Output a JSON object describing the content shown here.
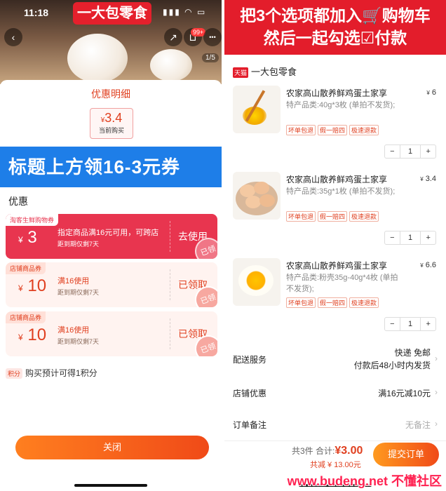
{
  "left": {
    "status_time": "11:18",
    "status_icons": "▮▮▮ ◠ ▭",
    "brand_banner": "一大包零食",
    "back_icon": "‹",
    "share_icon": "↗",
    "cart_badge": "99+",
    "more_icon": "•••",
    "photo_index": "1/5",
    "sheet_title": "优惠明细",
    "price": {
      "currency": "¥",
      "value": "3.4",
      "label": "当前购买"
    },
    "blue_banner": "标题上方领16-3元券",
    "section_label": "优惠",
    "coupons": [
      {
        "tag": "淘客生鲜购物券",
        "currency": "¥",
        "amount": "3",
        "condition": "指定商品满16元可用，可跨店",
        "expiry": "距到期仅剩7天",
        "action": "去使用",
        "stamp": "已领"
      },
      {
        "tag": "店铺商品券",
        "currency": "¥",
        "amount": "10",
        "condition": "满16使用",
        "expiry": "距到期仅剩7天",
        "action": "已领取",
        "stamp": "已领"
      },
      {
        "tag": "店铺商品券",
        "currency": "¥",
        "amount": "10",
        "condition": "满16使用",
        "expiry": "距到期仅剩7天",
        "action": "已领取",
        "stamp": "已领"
      }
    ],
    "points_badge": "积分",
    "points_text": "购买预计可得1积分",
    "close_button": "关闭"
  },
  "right": {
    "banner_line1": "把3个选项都加入🛒购物车",
    "banner_line2": "然后一起勾选☑付款",
    "shop_badge": "天猫",
    "shop_name": "一大包零食",
    "items": [
      {
        "name": "农家高山散养鲜鸡蛋土家享",
        "spec": "特产品类:40g*3枚 (单拍不发货);",
        "price_currency": "¥",
        "price": "6",
        "tags": [
          "坏单包退",
          "假一赔四",
          "极速退款"
        ],
        "minus": "−",
        "qty": "1",
        "plus": "+"
      },
      {
        "name": "农家高山散养鲜鸡蛋土家享",
        "spec": "特产品类:35g*1枚 (单拍不发货);",
        "price_currency": "¥",
        "price": "3.4",
        "tags": [
          "坏单包退",
          "假一赔四",
          "极速退款"
        ],
        "minus": "−",
        "qty": "1",
        "plus": "+"
      },
      {
        "name": "农家高山散养鲜鸡蛋土家享",
        "spec": "特产品类:粉壳35g-40g*4枚 (单拍不发货);",
        "price_currency": "¥",
        "price": "6.6",
        "tags": [
          "坏单包退",
          "假一赔四",
          "极速退款"
        ],
        "minus": "−",
        "qty": "1",
        "plus": "+"
      }
    ],
    "delivery": {
      "label": "配送服务",
      "value1": "快递 免邮",
      "value2": "付款后48小时内发货"
    },
    "shop_discount": {
      "label": "店铺优惠",
      "value": "满16元减10元"
    },
    "order_note": {
      "label": "订单备注",
      "value": "无备注"
    },
    "total_prefix": "共3件 合计:",
    "total_currency": "¥",
    "total_value": "3.00",
    "saved": "共减 ¥ 13.00元",
    "submit_button": "提交订单",
    "watermark": "www.budeng.net 不懂社区"
  },
  "colors": {
    "brand_red": "#e31d2b",
    "accent_orange": "#f04a18",
    "banner_blue": "#1e7ee8"
  }
}
